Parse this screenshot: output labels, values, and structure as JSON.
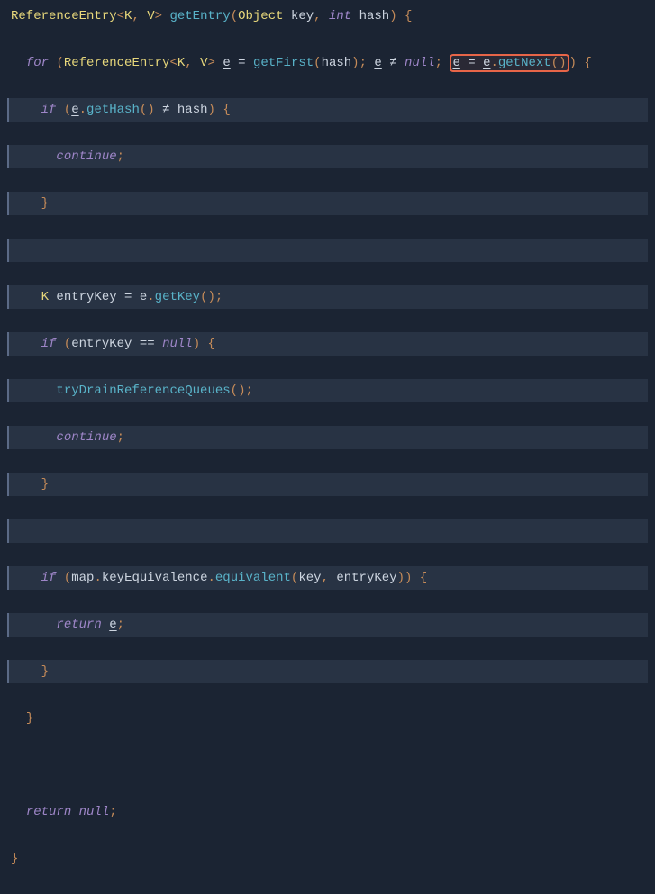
{
  "sig": {
    "ReferenceEntry": "ReferenceEntry",
    "K": "K",
    "V": "V",
    "getEntry": "getEntry",
    "Object": "Object",
    "key": "key",
    "int": "int",
    "hash": "hash"
  },
  "t": {
    "for": "for",
    "if": "if",
    "continue": "continue",
    "return": "return",
    "null": "null",
    "neq": "≠",
    "eq": "==",
    "e": "e",
    "getFirst": "getFirst",
    "getNext": "getNext",
    "getHash": "getHash",
    "getKey": "getKey",
    "entryKey": "entryKey",
    "tryDrainReferenceQueues": "tryDrainReferenceQueues",
    "map": "map",
    "keyEquivalence": "keyEquivalence",
    "equivalent": "equivalent",
    "lt": "<",
    "gt": ">",
    "lp": "(",
    "rp": ")",
    "lb": "{",
    "rb": "}",
    "c": ",",
    "sc": ";",
    "dot": ".",
    "asg": "=",
    "sp1": " ",
    "sp2": "  ",
    "sp4": "    ",
    "sp6": "      ",
    "sp8": "        "
  }
}
